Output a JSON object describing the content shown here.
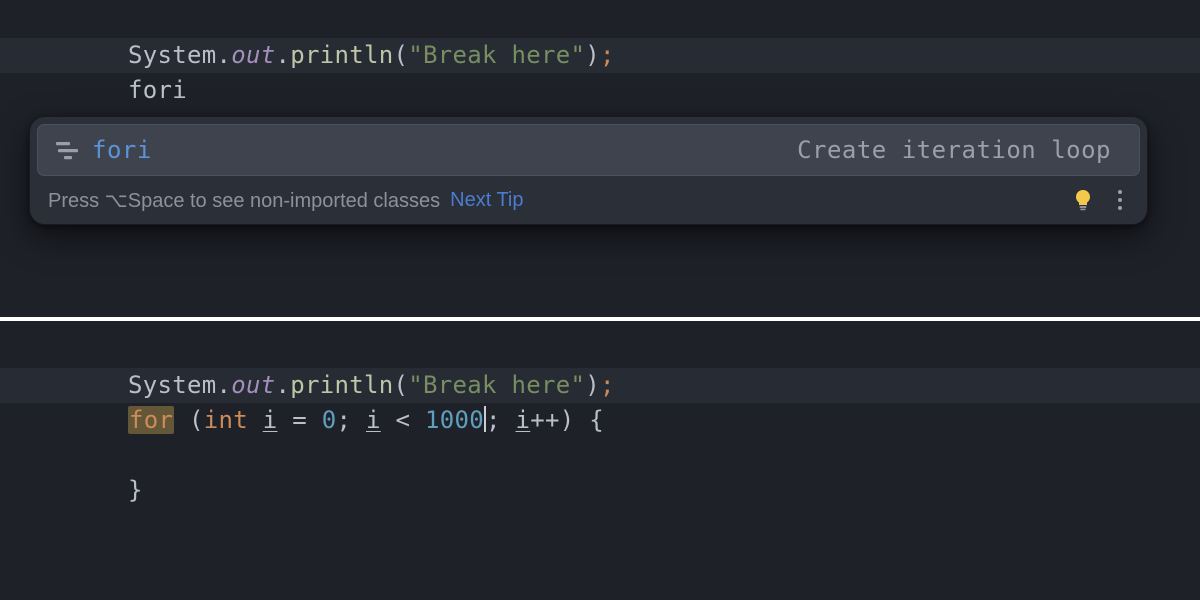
{
  "top_editor": {
    "line1": {
      "t1": "System.",
      "t2": "out",
      "t3": ".",
      "t4": "println",
      "t5": "(",
      "t6": "\"Break here\"",
      "t7": ")",
      "t8": ";"
    },
    "line2": {
      "text": "fori"
    }
  },
  "autocomplete": {
    "items": [
      {
        "label": "fori",
        "desc": "Create iteration loop"
      }
    ],
    "footer_tip": "Press ⌥Space to see non-imported classes",
    "footer_link": "Next Tip"
  },
  "bottom_editor": {
    "line1": {
      "t1": "System.",
      "t2": "out",
      "t3": ".",
      "t4": "println",
      "t5": "(",
      "t6": "\"Break here\"",
      "t7": ")",
      "t8": ";"
    },
    "line2": {
      "t_for": "for",
      "sp1": " (",
      "t_int": "int",
      "sp2": " ",
      "t_i1": "i",
      "t_eq": " = ",
      "t_zero": "0",
      "t_semi1": "; ",
      "t_i2": "i",
      "t_lt": " < ",
      "t_thousand": "1000",
      "t_semi2": "; ",
      "t_i3": "i",
      "t_inc": "++) {"
    },
    "line3": {
      "text": ""
    },
    "line4": {
      "text": "}"
    }
  }
}
